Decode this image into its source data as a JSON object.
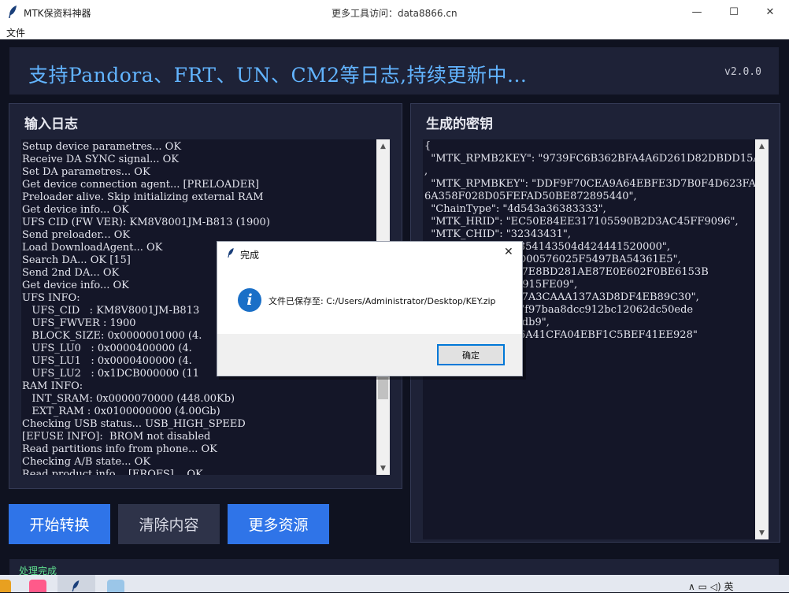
{
  "window": {
    "app_title": "MTK保资料神器",
    "center_title": "更多工具访问：data8866.cn",
    "minimize_label": "—",
    "maximize_label": "☐",
    "close_label": "✕"
  },
  "menu": {
    "file": "文件"
  },
  "header": {
    "title": "支持Pandora、FRT、UN、CM2等日志,持续更新中...",
    "version": "v2.0.0"
  },
  "left_panel": {
    "title": "输入日志",
    "lines": [
      "Setup device parametres... OK",
      "Receive DA SYNC signal... OK",
      "Set DA parametres... OK",
      "Get device connection agent... [PRELOADER]",
      "Preloader alive. Skip initializing external RAM",
      "Get device info... OK",
      "UFS CID (FW VER): KM8V8001JM-B813 (1900)",
      "Send preloader... OK",
      "Load DownloadAgent... OK",
      "Search DA... OK [15]",
      "Send 2nd DA... OK",
      "Get device info... OK",
      "UFS INFO:",
      "   UFS_CID   : KM8V8001JM-B813",
      "   UFS_FWVER : 1900",
      "   BLOCK_SIZE: 0x0000001000 (4.",
      "   UFS_LU0   : 0x0000400000 (4.",
      "   UFS_LU1   : 0x0000400000 (4.",
      "   UFS_LU2   : 0x1DCB000000 (11",
      "RAM INFO:",
      "   INT_SRAM: 0x0000070000 (448.00Kb)",
      "   EXT_RAM : 0x0100000000 (4.00Gb)",
      "Checking USB status... USB_HIGH_SPEED",
      "[EFUSE INFO]:  BROM not disabled",
      "Read partitions info from phone... OK",
      "Checking A/B state... OK",
      "Read product info... [EROFS]... OK"
    ]
  },
  "right_panel": {
    "title": "生成的密钥",
    "lines": [
      "{",
      "  \"MTK_RPMB2KEY\": \"9739FC6B362BFA4A6D261D82DBDD15A1\"",
      ",",
      "  \"MTK_RPMBKEY\": \"DDF9F70CEA9A64EBFE3D7B0F4D623FA586",
      "6A358F028D05FEFAD50BE872895440\",",
      "  \"ChainType\": \"4d543a36383333\",",
      "  \"MTK_HRID\": \"EC50E84EE317105590B2D3AC45FF9096\",",
      "  \"MTK_CHID\": \"32343431\",",
      "             39485131354143504d424441520000\",",
      "             D256CEDD00576025F5497BA54361E5\",",
      "              : \"2F172F7E8BD281AE87E0E602F0BE6153B",
      "             DAA14569915FE09\",",
      "             FB91625C7A3CAAA137A3D8DF4EB89C30\",",
      "             08c813557f97baa8dcc912bc12062dc50ede",
      "             88bd47c7fdb9\",",
      "             \"7A2524E6A41CFA04EBF1C5BEF41EE928\""
    ]
  },
  "buttons": {
    "start": "开始转换",
    "clear": "清除内容",
    "more": "更多资源"
  },
  "status": "处理完成",
  "tray": {
    "text": "∧ ▭ ◁) 英"
  },
  "dialog": {
    "title": "完成",
    "icon_glyph": "i",
    "message": "文件已保存至: C:/Users/Administrator/Desktop/KEY.zip",
    "ok_label": "确定",
    "close_label": "✕"
  },
  "colors": {
    "accent_blue": "#2f74e8",
    "header_text": "#62b4ff",
    "panel_bg": "#1e2237",
    "status_green": "#60e090"
  },
  "icons": [
    "feather-icon",
    "info-icon",
    "close-icon",
    "minimize-icon",
    "maximize-icon"
  ]
}
